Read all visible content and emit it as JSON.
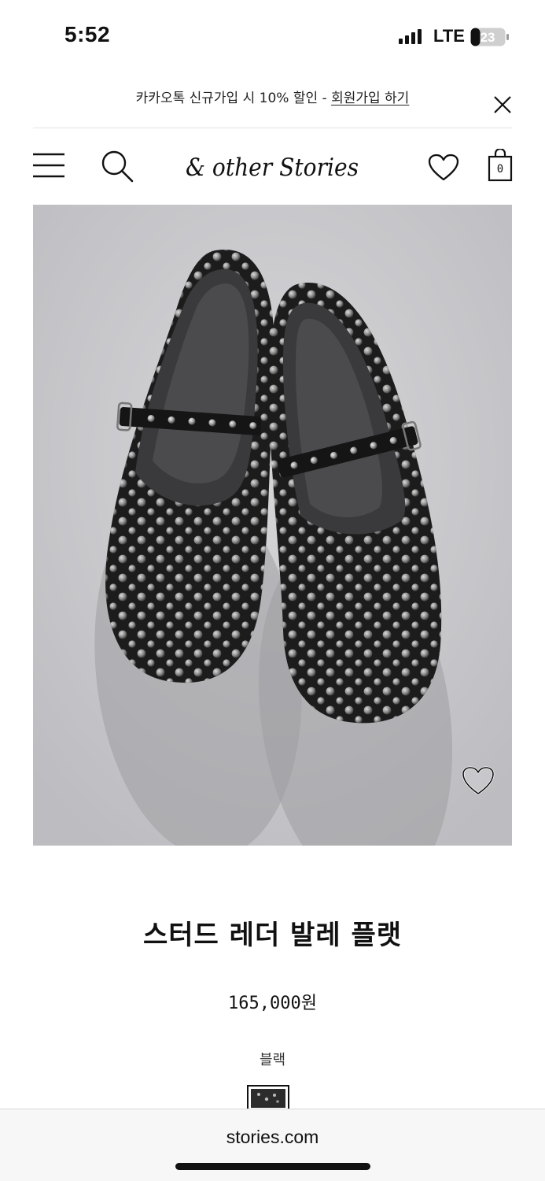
{
  "status_bar": {
    "time": "5:52",
    "network": "LTE",
    "battery_level": "23"
  },
  "promo_banner": {
    "text": "카카오톡 신규가입 시 10% 할인 - ",
    "link_label": "회원가입 하기"
  },
  "header": {
    "logo_text": "& other Stories",
    "bag_count": "0"
  },
  "product": {
    "name": "스터드 레더 발레 플랫",
    "price": "165,000원",
    "color_name": "블랙"
  },
  "browser": {
    "url": "stories.com"
  },
  "colors": {
    "image_background": "#c9c9cc",
    "shoe": "#1c1c1c",
    "stud": "#a8a8a8"
  },
  "icons": [
    "menu-icon",
    "search-icon",
    "heart-icon",
    "shopping-bag-icon",
    "close-icon",
    "wishlist-heart-icon"
  ]
}
